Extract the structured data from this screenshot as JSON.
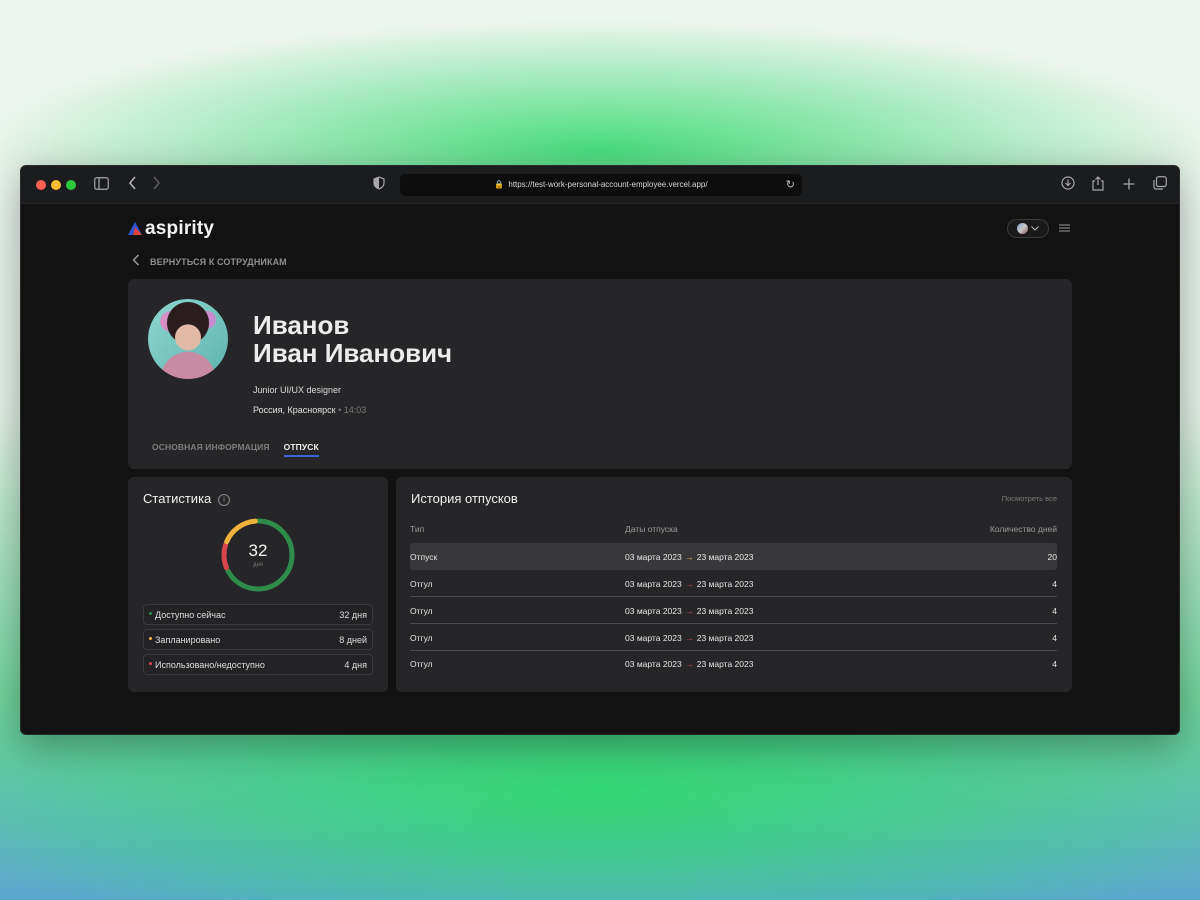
{
  "browser": {
    "url": "https://test-work-personal-account-employee.vercel.app/"
  },
  "header": {
    "logo_text": "aspirity"
  },
  "nav": {
    "back_label": "ВЕРНУТЬСЯ К СОТРУДНИКАМ"
  },
  "profile": {
    "last_name": "Иванов",
    "first_middle": "Иван Иванович",
    "role": "Junior UI/UX designer",
    "location": "Россия, Красноярск",
    "time": "• 14:03",
    "tabs": [
      {
        "label": "ОСНОВНАЯ ИНФОРМАЦИЯ",
        "active": false
      },
      {
        "label": "ОТПУСК",
        "active": true
      }
    ]
  },
  "stats": {
    "title": "Статистика",
    "total": "32",
    "unit": "дня",
    "donut_segments": [
      {
        "fraction": 0.6875,
        "color": "#2e8b4a"
      },
      {
        "fraction": 0.125,
        "color": "#d8454f"
      },
      {
        "fraction": 0.1875,
        "color": "#f0b23a"
      }
    ],
    "rows": [
      {
        "label": "Доступно сейчас",
        "value": "32 дня",
        "color": "#2e8b4a"
      },
      {
        "label": "Запланировано",
        "value": "8 дней",
        "color": "#f0b23a"
      },
      {
        "label": "Использовано/недоступно",
        "value": "4 дня",
        "color": "#d8454f"
      }
    ]
  },
  "history": {
    "title": "История отпусков",
    "view_all": "Посмотреть все",
    "columns": [
      "Тип",
      "Даты отпуска",
      "Количество дней"
    ],
    "rows": [
      {
        "type": "Отпуск",
        "from": "03 марта 2023",
        "to": "23 марта 2023",
        "days": "20",
        "arrow_color": "#f0b23a"
      },
      {
        "type": "Отгул",
        "from": "03 марта 2023",
        "to": "23 марта 2023",
        "days": "4",
        "arrow_color": "#d8454f"
      },
      {
        "type": "Отгул",
        "from": "03 марта 2023",
        "to": "23 марта 2023",
        "days": "4",
        "arrow_color": "#d8454f"
      },
      {
        "type": "Отгул",
        "from": "03 марта 2023",
        "to": "23 марта 2023",
        "days": "4",
        "arrow_color": "#d8454f"
      },
      {
        "type": "Отгул",
        "from": "03 марта 2023",
        "to": "23 марта 2023",
        "days": "4",
        "arrow_color": "#d8454f"
      }
    ]
  },
  "colors": {
    "accent": "#3d63dd",
    "logo_blue": "#2d56d6",
    "logo_red": "#e0413a"
  }
}
